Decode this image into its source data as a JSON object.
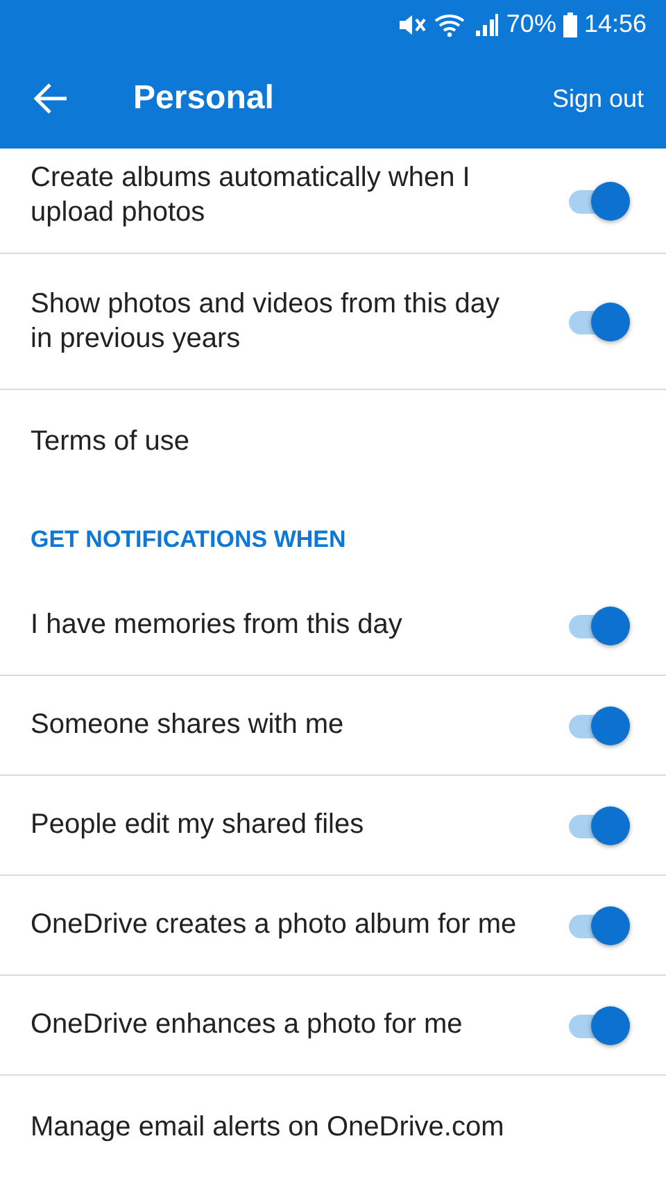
{
  "status_bar": {
    "battery": "70%",
    "time": "14:56"
  },
  "app_bar": {
    "title": "Personal",
    "action": "Sign out"
  },
  "items": [
    {
      "kind": "toggle",
      "label": "Create albums automatically when I upload photos",
      "on": true
    },
    {
      "kind": "toggle",
      "label": "Show photos and videos from this day in previous years",
      "on": true
    },
    {
      "kind": "link",
      "label": "Terms of use"
    },
    {
      "kind": "header",
      "label": "GET NOTIFICATIONS WHEN"
    },
    {
      "kind": "toggle",
      "label": "I have memories from this day",
      "on": true
    },
    {
      "kind": "toggle",
      "label": "Someone shares with me",
      "on": true
    },
    {
      "kind": "toggle",
      "label": "People edit my shared files",
      "on": true
    },
    {
      "kind": "toggle",
      "label": "OneDrive creates a photo album for me",
      "on": true
    },
    {
      "kind": "toggle",
      "label": "OneDrive enhances a photo for me",
      "on": true
    },
    {
      "kind": "link",
      "label": "Manage email alerts on OneDrive.com"
    }
  ]
}
